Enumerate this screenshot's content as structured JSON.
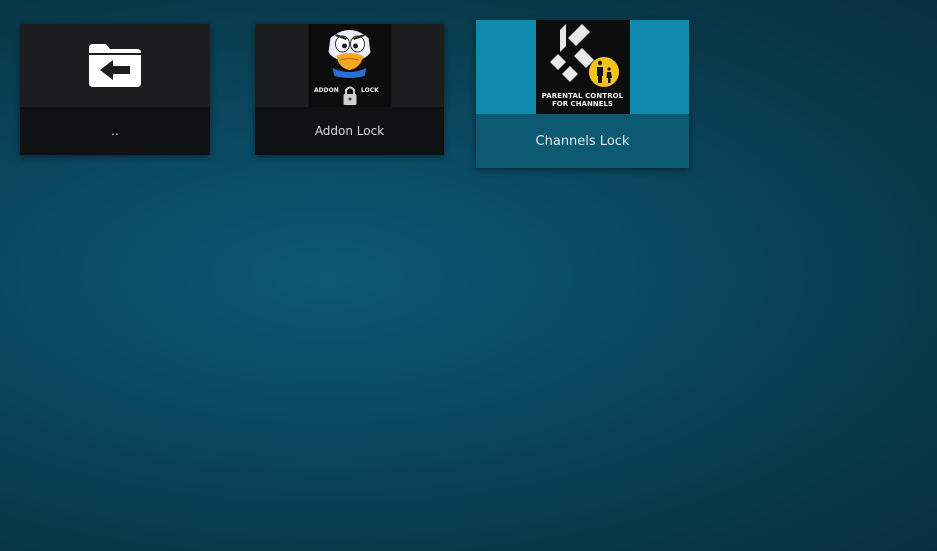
{
  "items": [
    {
      "label": "..",
      "icon": "folder-back-icon"
    },
    {
      "label": "Addon Lock",
      "icon": "addon-lock-thumbnail",
      "art_left": "ADDON",
      "art_right": "LOCK"
    },
    {
      "label": "Channels Lock",
      "icon": "parental-control-thumbnail",
      "art_line1": "PARENTAL CONTROL",
      "art_line2": "FOR CHANNELS",
      "selected": true
    }
  ],
  "colors": {
    "selected_tile": "#1089ae",
    "accent_yellow": "#f7c21b"
  }
}
